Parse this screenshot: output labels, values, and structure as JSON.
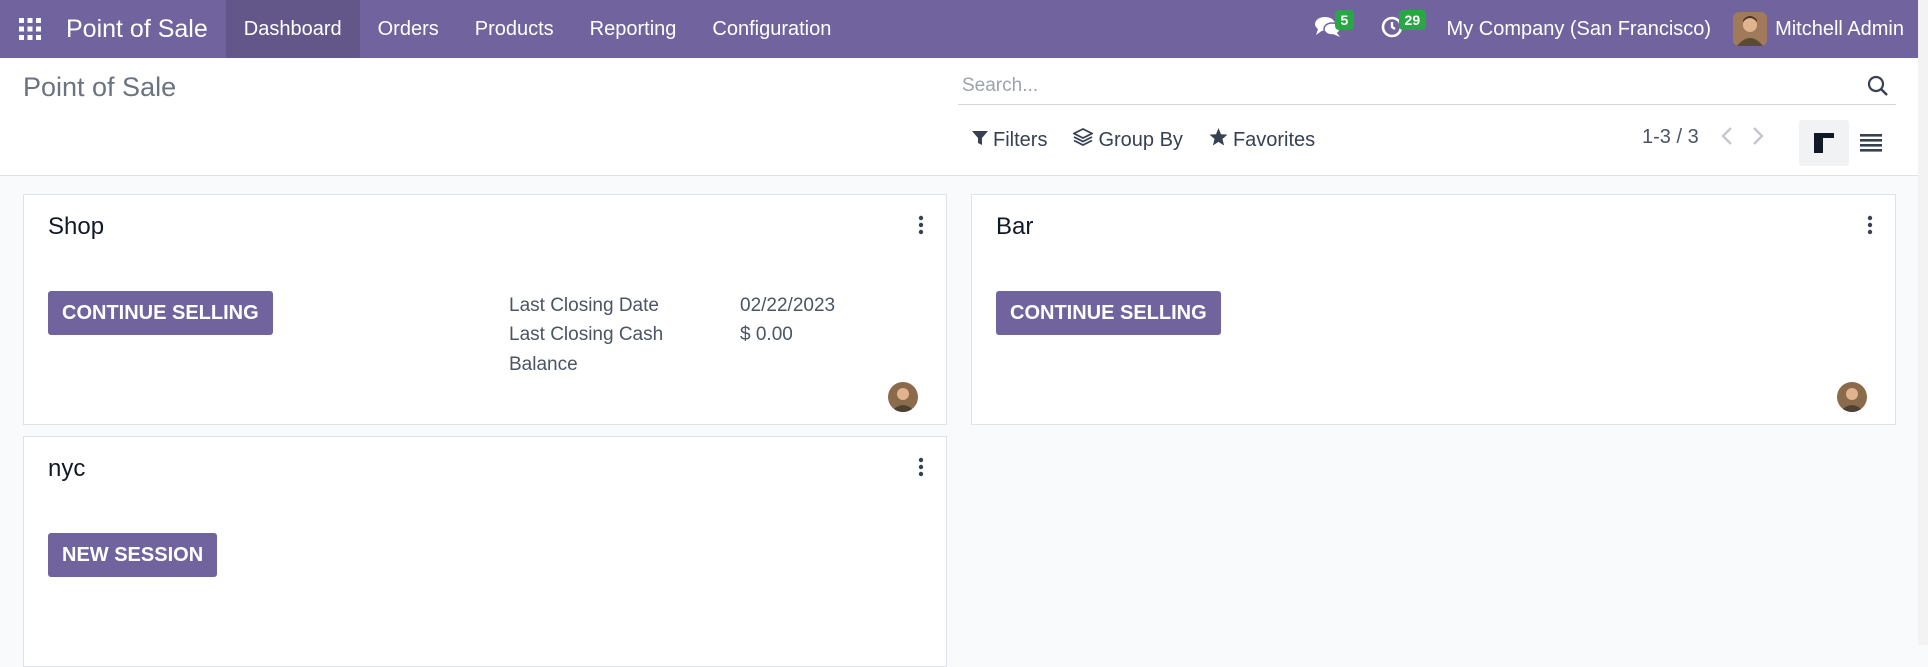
{
  "navbar": {
    "brand": "Point of Sale",
    "menu": [
      "Dashboard",
      "Orders",
      "Products",
      "Reporting",
      "Configuration"
    ],
    "active_menu": "Dashboard",
    "messages_count": "5",
    "activities_count": "29",
    "company": "My Company (San Francisco)",
    "user": "Mitchell Admin",
    "accent_color": "#71639e"
  },
  "control_panel": {
    "title": "Point of Sale",
    "search_placeholder": "Search...",
    "filters_label": "Filters",
    "group_by_label": "Group By",
    "favorites_label": "Favorites",
    "pager": "1-3 / 3"
  },
  "cards": [
    {
      "name": "Shop",
      "button": "CONTINUE SELLING",
      "last_closing_date_label": "Last Closing Date",
      "last_closing_date": "02/22/2023",
      "last_closing_cash_label": "Last Closing Cash",
      "last_closing_cash_label2": "Balance",
      "last_closing_cash": "$ 0.00"
    },
    {
      "name": "Bar",
      "button": "CONTINUE SELLING"
    },
    {
      "name": "nyc",
      "button": "NEW SESSION"
    }
  ]
}
